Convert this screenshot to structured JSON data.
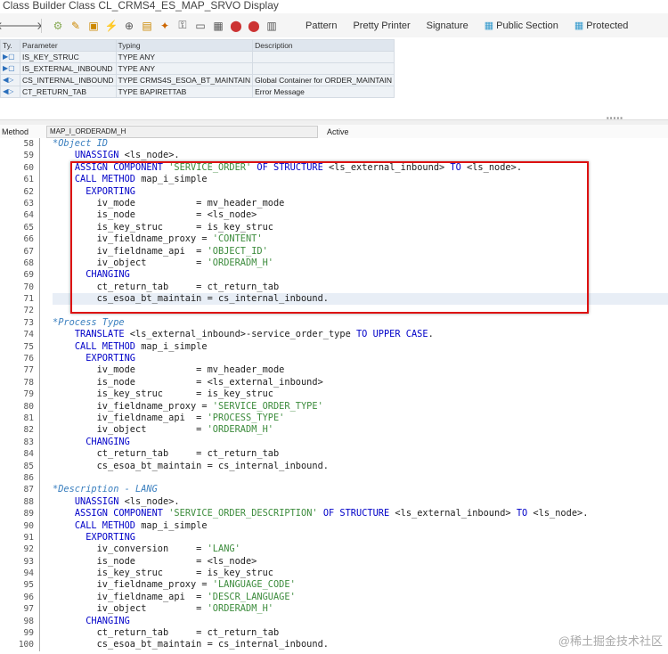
{
  "window": {
    "title": "Class Builder Class CL_CRMS4_ES_MAP_SRVO Display"
  },
  "toolbar": {
    "icons": [
      "back-arrow-icon",
      "forward-arrow-icon",
      "other-object-icon",
      "display-change-icon",
      "activate-icon",
      "check-icon",
      "where-used-icon",
      "object-list-icon",
      "navigation-window-icon",
      "enhance-icon",
      "breakpoint-icon",
      "signature-icon",
      "layout-icon",
      "help-icon"
    ],
    "buttons": [
      "Pattern",
      "Pretty Printer",
      "Signature",
      "Public Section",
      "Protected"
    ]
  },
  "params": {
    "headers": [
      "Ty.",
      "Parameter",
      "Typing",
      "Description"
    ],
    "rows": [
      {
        "ty": "▶▢",
        "param": "IS_KEY_STRUC",
        "typing": "TYPE ANY",
        "desc": ""
      },
      {
        "ty": "▶▢",
        "param": "IS_EXTERNAL_INBOUND",
        "typing": "TYPE ANY",
        "desc": ""
      },
      {
        "ty": "◀▷",
        "param": "CS_INTERNAL_INBOUND",
        "typing": "TYPE CRMS4S_ESOA_BT_MAINTAIN",
        "desc": "Global Container for ORDER_MAINTAIN"
      },
      {
        "ty": "◀▷",
        "param": "CT_RETURN_TAB",
        "typing": "TYPE BAPIRETTAB",
        "desc": "Error Message"
      }
    ]
  },
  "method": {
    "label": "Method",
    "name": "MAP_I_ORDERADM_H",
    "status": "Active"
  },
  "code": [
    {
      "n": "58",
      "html": "<span class='cm'>*Object ID</span>"
    },
    {
      "n": "59",
      "html": "    <span class='kw'>UNASSIGN</span> &lt;ls_node&gt;."
    },
    {
      "n": "60",
      "html": "    <span class='kw'>ASSIGN COMPONENT</span> <span class='st'>'SERVICE_ORDER'</span> <span class='kw'>OF STRUCTURE</span> &lt;ls_external_inbound&gt; <span class='kw'>TO</span> &lt;ls_node&gt;."
    },
    {
      "n": "61",
      "html": "    <span class='kw'>CALL METHOD</span> map_i_simple"
    },
    {
      "n": "62",
      "html": "      <span class='kw'>EXPORTING</span>"
    },
    {
      "n": "63",
      "html": "        iv_mode           = mv_header_mode"
    },
    {
      "n": "64",
      "html": "        is_node           = &lt;ls_node&gt;"
    },
    {
      "n": "65",
      "html": "        is_key_struc      = is_key_struc"
    },
    {
      "n": "66",
      "html": "        iv_fieldname_proxy = <span class='st'>'CONTENT'</span>"
    },
    {
      "n": "67",
      "html": "        iv_fieldname_api  = <span class='st'>'OBJECT_ID'</span>"
    },
    {
      "n": "68",
      "html": "        iv_object         = <span class='st'>'ORDERADM_H'</span>"
    },
    {
      "n": "69",
      "html": "      <span class='kw'>CHANGING</span>"
    },
    {
      "n": "70",
      "html": "        ct_return_tab     = ct_return_tab"
    },
    {
      "n": "71",
      "html": "        cs_esoa_bt_maintain = cs_internal_inbound.",
      "hl": true
    },
    {
      "n": "72",
      "html": ""
    },
    {
      "n": "73",
      "html": "<span class='cm'>*Process Type</span>"
    },
    {
      "n": "74",
      "html": "    <span class='kw'>TRANSLATE</span> &lt;ls_external_inbound&gt;-service_order_type <span class='kw'>TO UPPER CASE</span>."
    },
    {
      "n": "75",
      "html": "    <span class='kw'>CALL METHOD</span> map_i_simple"
    },
    {
      "n": "76",
      "html": "      <span class='kw'>EXPORTING</span>"
    },
    {
      "n": "77",
      "html": "        iv_mode           = mv_header_mode"
    },
    {
      "n": "78",
      "html": "        is_node           = &lt;ls_external_inbound&gt;"
    },
    {
      "n": "79",
      "html": "        is_key_struc      = is_key_struc"
    },
    {
      "n": "80",
      "html": "        iv_fieldname_proxy = <span class='st'>'SERVICE_ORDER_TYPE'</span>"
    },
    {
      "n": "81",
      "html": "        iv_fieldname_api  = <span class='st'>'PROCESS_TYPE'</span>"
    },
    {
      "n": "82",
      "html": "        iv_object         = <span class='st'>'ORDERADM_H'</span>"
    },
    {
      "n": "83",
      "html": "      <span class='kw'>CHANGING</span>"
    },
    {
      "n": "84",
      "html": "        ct_return_tab     = ct_return_tab"
    },
    {
      "n": "85",
      "html": "        cs_esoa_bt_maintain = cs_internal_inbound."
    },
    {
      "n": "86",
      "html": ""
    },
    {
      "n": "87",
      "html": "<span class='cm'>*Description - LANG</span>"
    },
    {
      "n": "88",
      "html": "    <span class='kw'>UNASSIGN</span> &lt;ls_node&gt;."
    },
    {
      "n": "89",
      "html": "    <span class='kw'>ASSIGN COMPONENT</span> <span class='st'>'SERVICE_ORDER_DESCRIPTION'</span> <span class='kw'>OF STRUCTURE</span> &lt;ls_external_inbound&gt; <span class='kw'>TO</span> &lt;ls_node&gt;."
    },
    {
      "n": "90",
      "html": "    <span class='kw'>CALL METHOD</span> map_i_simple"
    },
    {
      "n": "91",
      "html": "      <span class='kw'>EXPORTING</span>"
    },
    {
      "n": "92",
      "html": "        iv_conversion     = <span class='st'>'LANG'</span>"
    },
    {
      "n": "93",
      "html": "        is_node           = &lt;ls_node&gt;"
    },
    {
      "n": "94",
      "html": "        is_key_struc      = is_key_struc"
    },
    {
      "n": "95",
      "html": "        iv_fieldname_proxy = <span class='st'>'LANGUAGE_CODE'</span>"
    },
    {
      "n": "96",
      "html": "        iv_fieldname_api  = <span class='st'>'DESCR_LANGUAGE'</span>"
    },
    {
      "n": "97",
      "html": "        iv_object         = <span class='st'>'ORDERADM_H'</span>"
    },
    {
      "n": "98",
      "html": "      <span class='kw'>CHANGING</span>"
    },
    {
      "n": "99",
      "html": "        ct_return_tab     = ct_return_tab"
    },
    {
      "n": "100",
      "html": "        cs_esoa_bt_maintain = cs_internal_inbound."
    }
  ],
  "watermark": "@稀土掘金技术社区"
}
